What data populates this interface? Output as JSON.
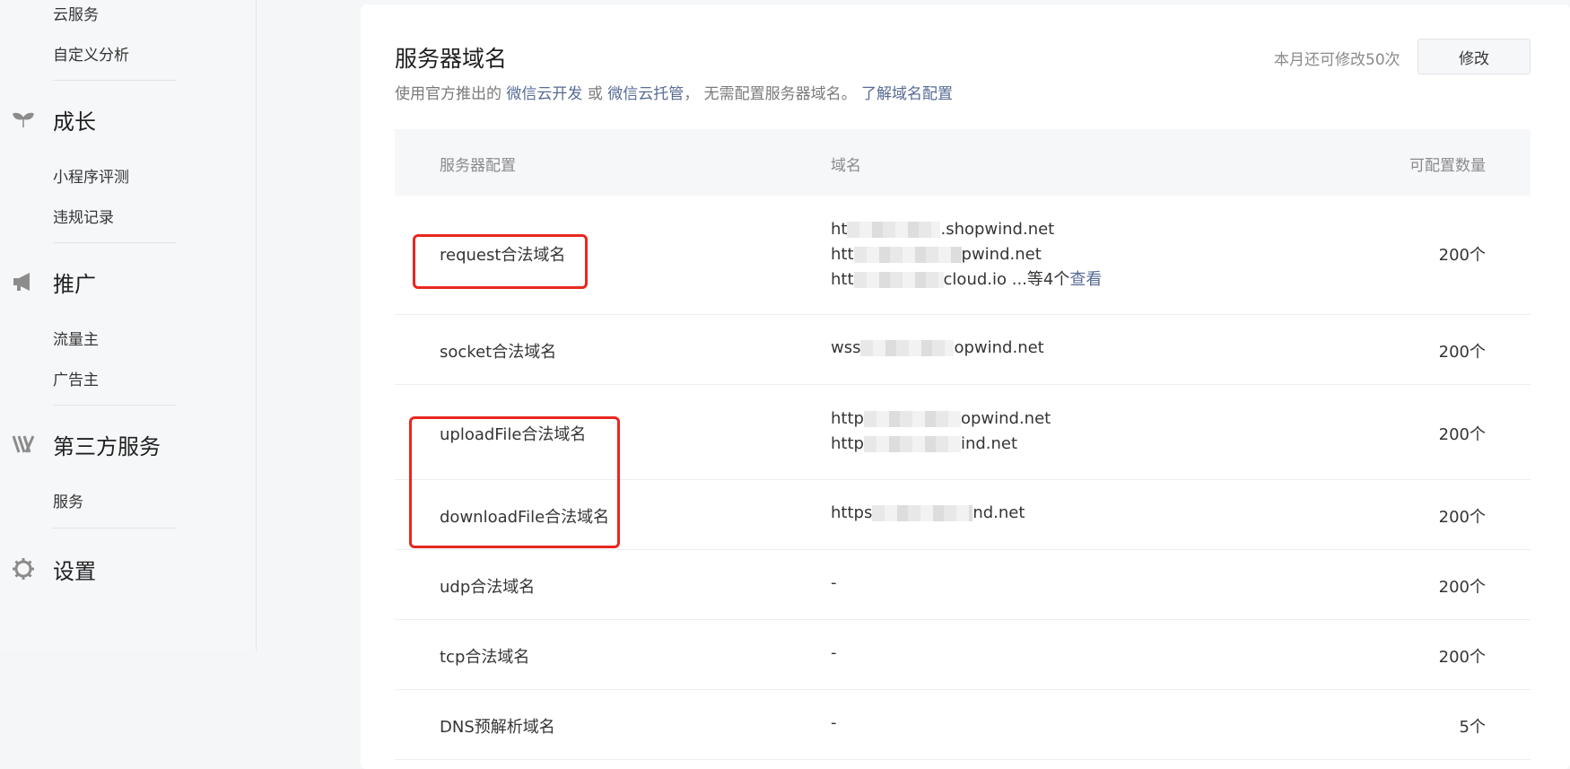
{
  "sidebar": {
    "top_items": [
      "云服务",
      "自定义分析"
    ],
    "groups": [
      {
        "label": "成长",
        "icon": "sprout-icon",
        "items": [
          "小程序评测",
          "违规记录"
        ]
      },
      {
        "label": "推广",
        "icon": "megaphone-icon",
        "items": [
          "流量主",
          "广告主"
        ]
      },
      {
        "label": "第三方服务",
        "icon": "third-party-icon",
        "items": [
          "服务"
        ]
      },
      {
        "label": "设置",
        "icon": "gear-icon",
        "items": []
      }
    ]
  },
  "main": {
    "title": "服务器域名",
    "desc_prefix": "使用官方推出的",
    "link_cloud_dev": "微信云开发",
    "desc_or": "或",
    "link_cloud_host": "微信云托管",
    "desc_suffix": "， 无需配置服务器域名。",
    "link_learn": "了解域名配置",
    "quota_text": "本月还可修改50次",
    "modify_button": "修改"
  },
  "table": {
    "headers": [
      "服务器配置",
      "域名",
      "可配置数量"
    ],
    "rows": [
      {
        "config": "request合法域名",
        "domains": [
          "ht",
          ".shopwind.net",
          "htt",
          "pwind.net",
          "htt",
          "cloud.io ...等4个"
        ],
        "more_link": "查看",
        "count": "200个"
      },
      {
        "config": "socket合法域名",
        "domains": [
          "wss",
          "opwind.net"
        ],
        "count": "200个"
      },
      {
        "config": "uploadFile合法域名",
        "domains": [
          "http",
          "opwind.net",
          "http",
          "ind.net"
        ],
        "count": "200个"
      },
      {
        "config": "downloadFile合法域名",
        "domains": [
          "https",
          "nd.net"
        ],
        "count": "200个"
      },
      {
        "config": "udp合法域名",
        "domains": [
          "-"
        ],
        "count": "200个"
      },
      {
        "config": "tcp合法域名",
        "domains": [
          "-"
        ],
        "count": "200个"
      },
      {
        "config": "DNS预解析域名",
        "domains": [
          "-"
        ],
        "count": "5个"
      }
    ]
  },
  "colors": {
    "link": "#576b95",
    "highlight": "#e8271f",
    "background": "#f5f6f8"
  }
}
